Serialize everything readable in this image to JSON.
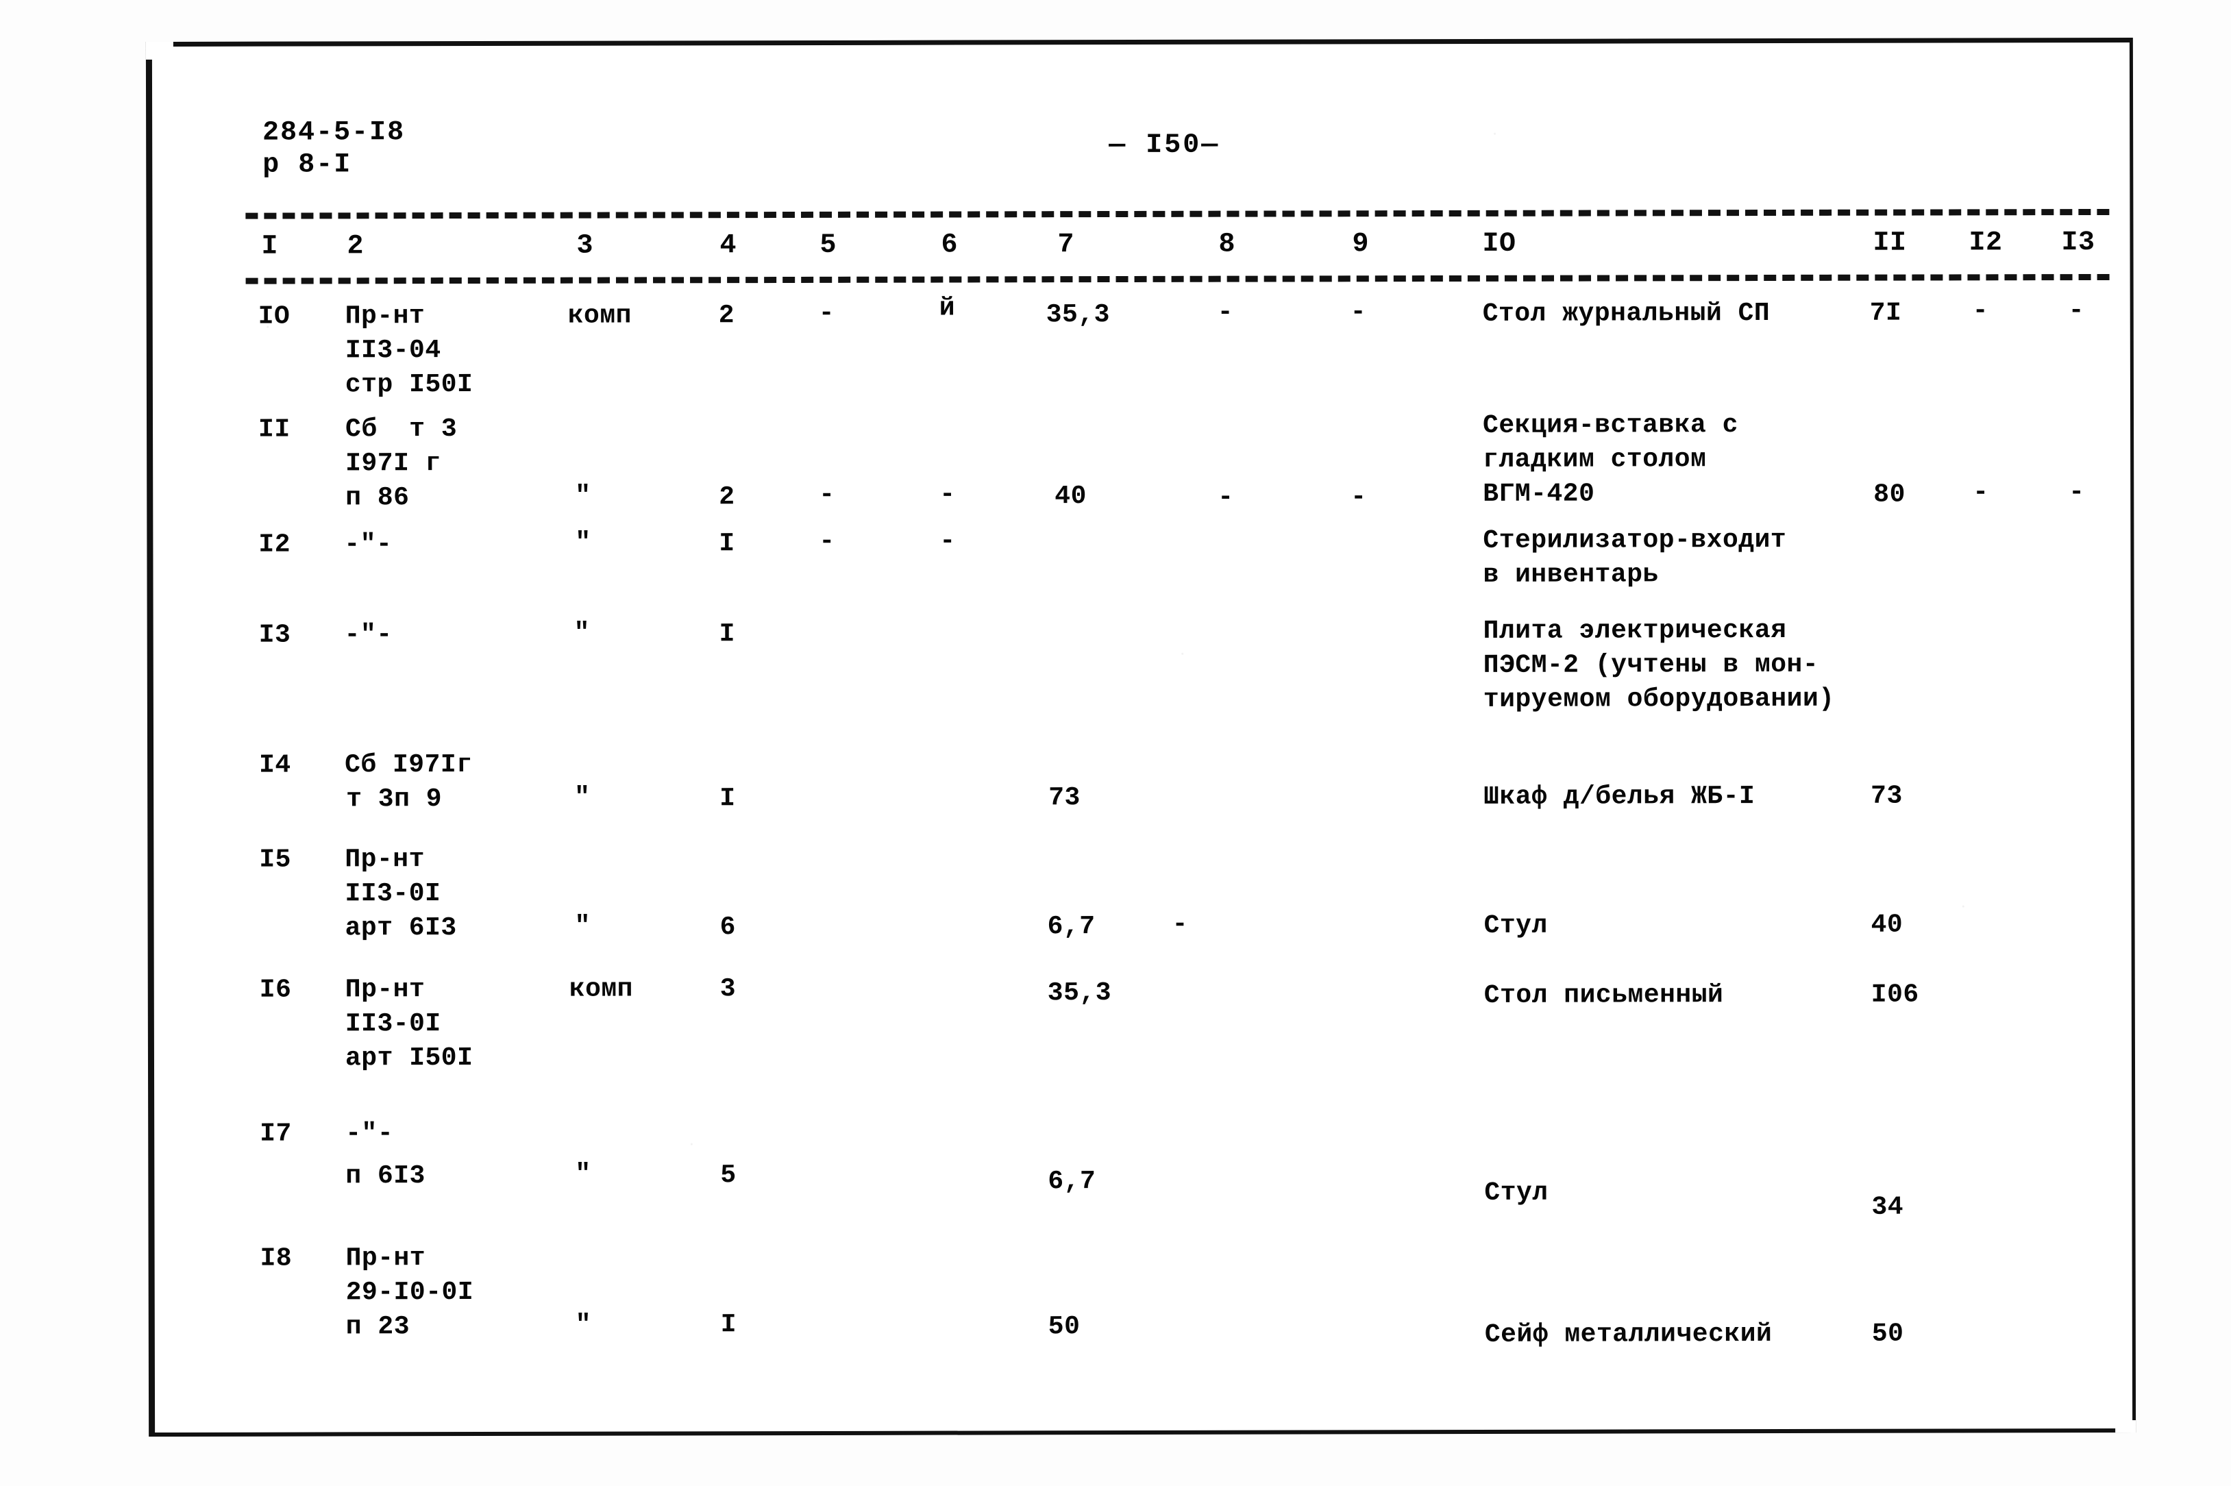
{
  "document": {
    "code_line1": "284-5-I8",
    "code_line2": "р 8-I",
    "page_marker": "— I50—"
  },
  "table": {
    "column_headers": [
      "I",
      "2",
      "3",
      "4",
      "5",
      "6",
      "7",
      "8",
      "9",
      "IO",
      "II",
      "I2",
      "I3"
    ],
    "rows": [
      {
        "c1": "IO",
        "c2_lines": [
          "Пр-нт",
          "II3-04",
          "стр I50I"
        ],
        "c3": "комп",
        "c4": "2",
        "c5": "-",
        "c6": "й",
        "c7": "35,3",
        "c8": "-",
        "c9": "-",
        "c10_lines": [
          "Стол журнальный СП"
        ],
        "c11": "7I",
        "c12": "-",
        "c13": "-"
      },
      {
        "c1": "II",
        "c2_lines": [
          "Сб  т 3",
          "I97I г",
          "п 86"
        ],
        "c3": "\"",
        "c4": "2",
        "c5": "-",
        "c6": "-",
        "c7": "40",
        "c8": "-",
        "c9": "-",
        "c10_lines": [
          "Секция-вставка с",
          "гладким столом",
          "ВГМ-420"
        ],
        "c11": "80",
        "c12": "-",
        "c13": "-"
      },
      {
        "c1": "I2",
        "c2_lines": [
          "-\"-"
        ],
        "c3": "\"",
        "c4": "I",
        "c5": "-",
        "c6": "-",
        "c7": "",
        "c8": "",
        "c9": "",
        "c10_lines": [
          "Стерилизатор-входит",
          "в инвентарь"
        ],
        "c11": "",
        "c12": "",
        "c13": ""
      },
      {
        "c1": "I3",
        "c2_lines": [
          "-\"-"
        ],
        "c3": "\"",
        "c4": "I",
        "c5": "",
        "c6": "",
        "c7": "",
        "c8": "",
        "c9": "",
        "c10_lines": [
          "Плита электрическая",
          "ПЭСМ-2 (учтены в мон-",
          "тируемом оборудовании)"
        ],
        "c11": "",
        "c12": "",
        "c13": ""
      },
      {
        "c1": "I4",
        "c2_lines": [
          "Сб I97Iг",
          "т 3п 9"
        ],
        "c3": "\"",
        "c4": "I",
        "c5": "",
        "c6": "",
        "c7": "73",
        "c8": "",
        "c9": "",
        "c10_lines": [
          "Шкаф д/белья ЖБ-I"
        ],
        "c11": "73",
        "c12": "",
        "c13": ""
      },
      {
        "c1": "I5",
        "c2_lines": [
          "Пр-нт",
          "II3-0I",
          "арт 6I3"
        ],
        "c3": "\"",
        "c4": "6",
        "c5": "",
        "c6": "",
        "c7": "6,7",
        "c8": "-",
        "c9": "",
        "c10_lines": [
          "Стул"
        ],
        "c11": "40",
        "c12": "",
        "c13": ""
      },
      {
        "c1": "I6",
        "c2_lines": [
          "Пр-нт",
          "II3-0I",
          "арт I50I"
        ],
        "c3": "комп",
        "c4": "3",
        "c5": "",
        "c6": "",
        "c7": "35,3",
        "c8": "",
        "c9": "",
        "c10_lines": [
          "Стол письменный"
        ],
        "c11": "I06",
        "c12": "",
        "c13": ""
      },
      {
        "c1": "I7",
        "c2_lines": [
          "-\"-",
          "п 6I3"
        ],
        "c3": "\"",
        "c4": "5",
        "c5": "",
        "c6": "",
        "c7": "6,7",
        "c8": "",
        "c9": "",
        "c10_lines": [
          "Стул"
        ],
        "c11": "34",
        "c12": "",
        "c13": ""
      },
      {
        "c1": "I8",
        "c2_lines": [
          "Пр-нт",
          "29-I0-0I",
          "п 23"
        ],
        "c3": "\"",
        "c4": "I",
        "c5": "",
        "c6": "",
        "c7": "50",
        "c8": "",
        "c9": "",
        "c10_lines": [
          "Сейф металлический"
        ],
        "c11": "50",
        "c12": "",
        "c13": ""
      }
    ]
  }
}
